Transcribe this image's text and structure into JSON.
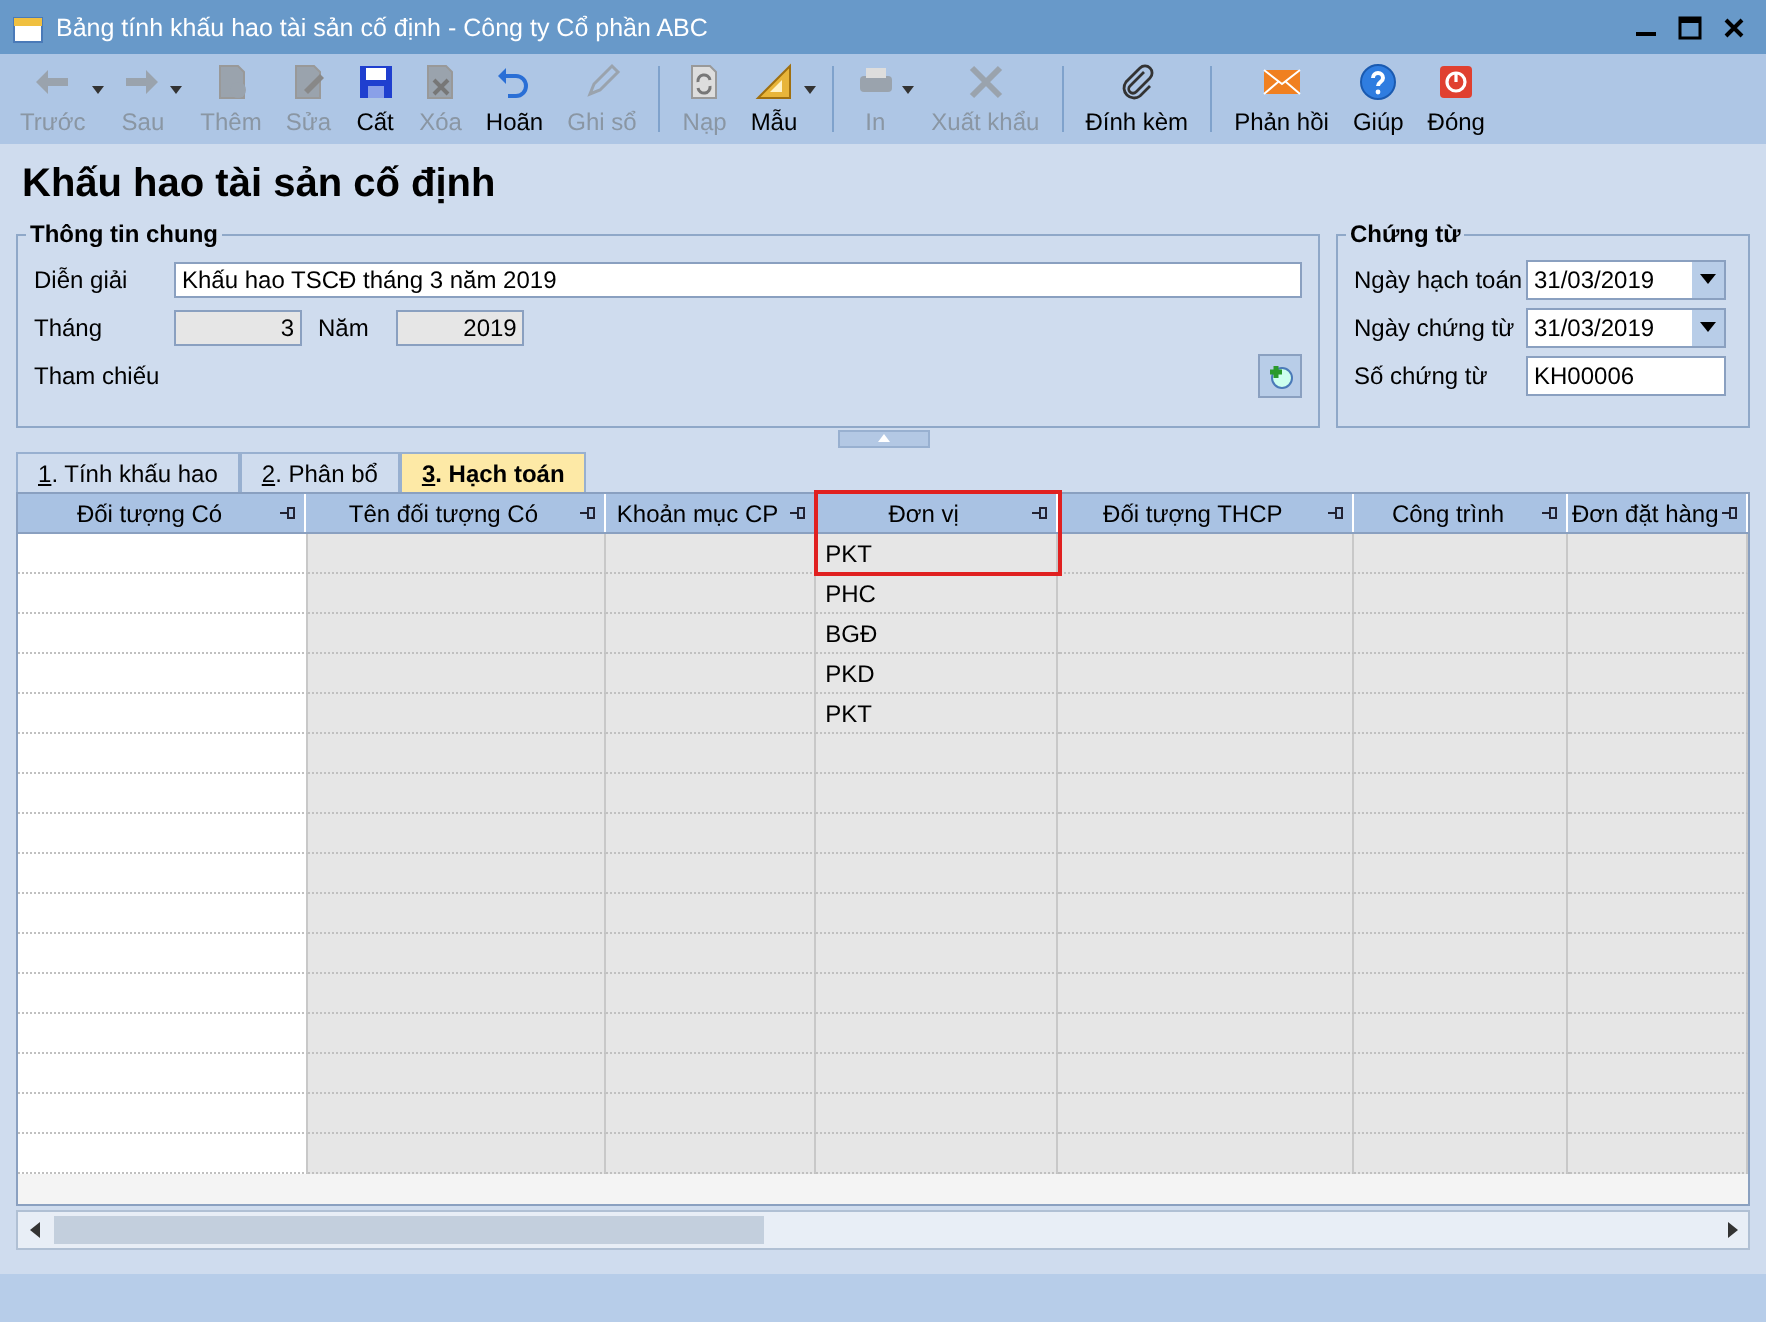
{
  "window": {
    "title": "Bảng tính khấu hao tài sản cố định - Công ty Cổ phần ABC"
  },
  "toolbar_groups": [
    [
      {
        "label": "Trước",
        "kind": "back",
        "disabled": true,
        "dropdown": true
      },
      {
        "label": "Sau",
        "kind": "forward",
        "disabled": true,
        "dropdown": true
      },
      {
        "label": "Thêm",
        "kind": "add",
        "disabled": true,
        "dropdown": false
      },
      {
        "label": "Sửa",
        "kind": "edit",
        "disabled": true,
        "dropdown": false
      },
      {
        "label": "Cất",
        "kind": "save",
        "disabled": false,
        "dropdown": false
      },
      {
        "label": "Xóa",
        "kind": "delete",
        "disabled": true,
        "dropdown": false
      },
      {
        "label": "Hoãn",
        "kind": "undo",
        "disabled": false,
        "dropdown": false
      },
      {
        "label": "Ghi sổ",
        "kind": "post",
        "disabled": true,
        "dropdown": false
      }
    ],
    [
      {
        "label": "Nạp",
        "kind": "reload",
        "disabled": true,
        "dropdown": false
      },
      {
        "label": "Mẫu",
        "kind": "template",
        "disabled": false,
        "dropdown": true
      }
    ],
    [
      {
        "label": "In",
        "kind": "print",
        "disabled": true,
        "dropdown": true
      },
      {
        "label": "Xuất khẩu",
        "kind": "export",
        "disabled": true,
        "dropdown": false
      }
    ],
    [
      {
        "label": "Đính kèm",
        "kind": "attach",
        "disabled": false,
        "dropdown": false
      }
    ],
    [
      {
        "label": "Phản hồi",
        "kind": "feedback",
        "disabled": false,
        "dropdown": false
      },
      {
        "label": "Giúp",
        "kind": "help",
        "disabled": false,
        "dropdown": false
      },
      {
        "label": "Đóng",
        "kind": "close",
        "disabled": false,
        "dropdown": false
      }
    ]
  ],
  "heading": "Khấu hao tài sản cố định",
  "general": {
    "legend": "Thông tin chung",
    "description_label": "Diễn giải",
    "description": "Khấu hao TSCĐ tháng 3 năm 2019",
    "month_label": "Tháng",
    "month": "3",
    "year_label": "Năm",
    "year": "2019",
    "reference_label": "Tham chiếu"
  },
  "voucher": {
    "legend": "Chứng từ",
    "fields": [
      {
        "label": "Ngày hạch toán",
        "value": "31/03/2019",
        "kind": "date"
      },
      {
        "label": "Ngày chứng từ",
        "value": "31/03/2019",
        "kind": "date"
      },
      {
        "label": "Số chứng từ",
        "value": "KH00006",
        "kind": "text"
      }
    ]
  },
  "tabs": [
    {
      "label": "1. Tính khấu hao",
      "selected": false
    },
    {
      "label": "2. Phân bổ",
      "selected": false
    },
    {
      "label": "3. Hạch toán",
      "selected": true
    }
  ],
  "table": {
    "columns": [
      {
        "title": "Đối tượng Có",
        "editable": true,
        "highlighted": false
      },
      {
        "title": "Tên đối tượng Có",
        "editable": false,
        "highlighted": false
      },
      {
        "title": "Khoản mục CP",
        "editable": false,
        "highlighted": false
      },
      {
        "title": "Đơn vị",
        "editable": false,
        "highlighted": true,
        "values": [
          "PKT",
          "PHC",
          "BGĐ",
          "PKD",
          "PKT"
        ]
      },
      {
        "title": "Đối tượng THCP",
        "editable": false,
        "highlighted": false
      },
      {
        "title": "Công trình",
        "editable": false,
        "highlighted": false
      },
      {
        "title": "Đơn đặt hàng",
        "editable": false,
        "highlighted": false
      }
    ]
  }
}
